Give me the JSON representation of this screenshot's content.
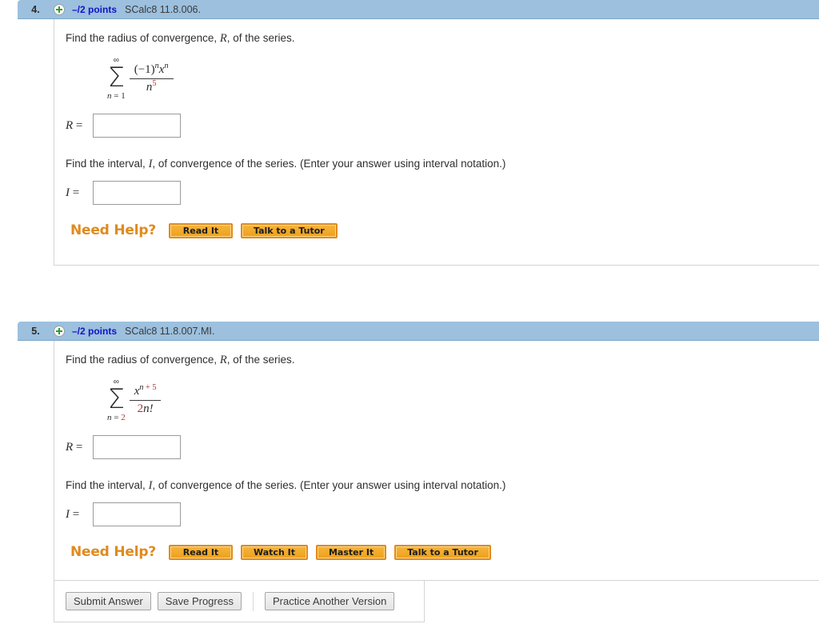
{
  "questions": [
    {
      "number": "4.",
      "plus_icon": "plus-circle-icon",
      "points": "–/2 points",
      "code": "SCalc8 11.8.006.",
      "prompt_radius_pre": "Find the radius of convergence, ",
      "prompt_radius_var": "R",
      "prompt_radius_post": ", of the series.",
      "series": {
        "upper_limit": "∞",
        "lower_limit_var": "n",
        "lower_limit_eq": " = ",
        "lower_limit_val": "1",
        "numerator_base": "(−1)",
        "numerator_exp1": "n",
        "numerator_x": "x",
        "numerator_exp2": "n",
        "denominator_base": "n",
        "denominator_exp": "5"
      },
      "radius_label_var": "R",
      "radius_label_eq": " =",
      "radius_value": "",
      "prompt_interval_pre": "Find the interval, ",
      "prompt_interval_var": "I",
      "prompt_interval_post": ", of convergence of the series. (Enter your answer using interval notation.)",
      "interval_label_var": "I",
      "interval_label_eq": " =",
      "interval_value": "",
      "need_help_label": "Need Help?",
      "help_buttons": [
        "Read It",
        "Talk to a Tutor"
      ]
    },
    {
      "number": "5.",
      "plus_icon": "plus-circle-icon",
      "points": "–/2 points",
      "code": "SCalc8 11.8.007.MI.",
      "prompt_radius_pre": "Find the radius of convergence, ",
      "prompt_radius_var": "R",
      "prompt_radius_post": ", of the series.",
      "series": {
        "upper_limit": "∞",
        "lower_limit_var": "n",
        "lower_limit_eq": " = ",
        "lower_limit_val": "2",
        "numerator_x": "x",
        "numerator_exp_n": "n",
        "numerator_exp_plus": " + 5",
        "denominator_coef": "2",
        "denominator_rest": "n!"
      },
      "radius_label_var": "R",
      "radius_label_eq": " =",
      "radius_value": "",
      "prompt_interval_pre": "Find the interval, ",
      "prompt_interval_var": "I",
      "prompt_interval_post": ", of convergence of the series. (Enter your answer using interval notation.)",
      "interval_label_var": "I",
      "interval_label_eq": " =",
      "interval_value": "",
      "need_help_label": "Need Help?",
      "help_buttons": [
        "Read It",
        "Watch It",
        "Master It",
        "Talk to a Tutor"
      ]
    }
  ],
  "submit_bar": {
    "submit_label": "Submit Answer",
    "save_label": "Save Progress",
    "practice_label": "Practice Another Version"
  },
  "colors": {
    "header_bar": "#9cc0de",
    "points_text": "#1414c8",
    "help_orange": "#e08a1e",
    "math_red": "#b23030",
    "plus_green": "#2e9c2e"
  }
}
